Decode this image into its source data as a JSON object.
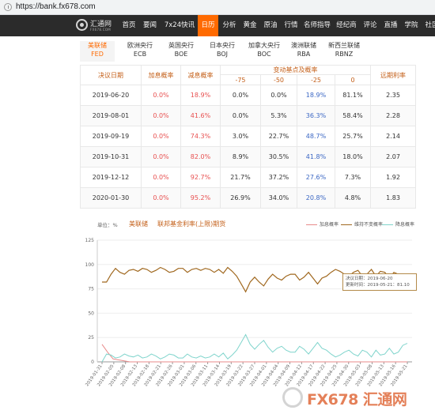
{
  "browser": {
    "url": "https://bank.fx678.com"
  },
  "logo": {
    "brand": "汇通网",
    "sub": "FX678.COM"
  },
  "nav": {
    "items": [
      {
        "label": "首页",
        "active": false
      },
      {
        "label": "要闻",
        "active": false
      },
      {
        "label": "7x24快讯",
        "active": false
      },
      {
        "label": "日历",
        "active": true
      },
      {
        "label": "分析",
        "active": false
      },
      {
        "label": "黄金",
        "active": false
      },
      {
        "label": "原油",
        "active": false
      },
      {
        "label": "行情",
        "active": false
      },
      {
        "label": "名师指导",
        "active": false
      },
      {
        "label": "经纪商",
        "active": false
      },
      {
        "label": "评论",
        "active": false
      },
      {
        "label": "直播",
        "active": false
      },
      {
        "label": "学院",
        "active": false
      },
      {
        "label": "社区",
        "active": false
      }
    ]
  },
  "tabs": [
    {
      "name": "美联储",
      "code": "FED",
      "active": true
    },
    {
      "name": "欧洲央行",
      "code": "ECB",
      "active": false
    },
    {
      "name": "英国央行",
      "code": "BOE",
      "active": false
    },
    {
      "name": "日本央行",
      "code": "BOJ",
      "active": false
    },
    {
      "name": "加拿大央行",
      "code": "BOC",
      "active": false
    },
    {
      "name": "澳洲联储",
      "code": "RBA",
      "active": false
    },
    {
      "name": "新西兰联储",
      "code": "RBNZ",
      "active": false
    }
  ],
  "table": {
    "headers": {
      "date": "决议日期",
      "hike": "加息概率",
      "cut": "减息概率",
      "change_group": "变动基点及概率",
      "change_cols": [
        "-75",
        "-50",
        "-25",
        "0"
      ],
      "forward": "远期利率"
    },
    "rows": [
      {
        "date": "2019-06-20",
        "hike": "0.0%",
        "cut": "18.9%",
        "c75": "0.0%",
        "c50": "0.0%",
        "c25": "18.9%",
        "c0": "81.1%",
        "fwd": "2.35"
      },
      {
        "date": "2019-08-01",
        "hike": "0.0%",
        "cut": "41.6%",
        "c75": "0.0%",
        "c50": "5.3%",
        "c25": "36.3%",
        "c0": "58.4%",
        "fwd": "2.28"
      },
      {
        "date": "2019-09-19",
        "hike": "0.0%",
        "cut": "74.3%",
        "c75": "3.0%",
        "c50": "22.7%",
        "c25": "48.7%",
        "c0": "25.7%",
        "fwd": "2.14"
      },
      {
        "date": "2019-10-31",
        "hike": "0.0%",
        "cut": "82.0%",
        "c75": "8.9%",
        "c50": "30.5%",
        "c25": "41.8%",
        "c0": "18.0%",
        "fwd": "2.07"
      },
      {
        "date": "2019-12-12",
        "hike": "0.0%",
        "cut": "92.7%",
        "c75": "21.7%",
        "c50": "37.2%",
        "c25": "27.6%",
        "c0": "7.3%",
        "fwd": "1.92"
      },
      {
        "date": "2020-01-30",
        "hike": "0.0%",
        "cut": "95.2%",
        "c75": "26.9%",
        "c50": "34.0%",
        "c25": "20.8%",
        "c0": "4.8%",
        "fwd": "1.83"
      }
    ]
  },
  "chart_header": {
    "unit": "单位：%",
    "title1": "美联储",
    "title2": "联邦基金利率(上限)期货"
  },
  "tooltip": {
    "line1": "决议日期：2019-06-20",
    "line2": "更新时间：2019-05-21：81.10"
  },
  "watermark": {
    "text": "FX678 汇通网"
  },
  "chart_data": {
    "type": "line",
    "ylim": [
      0,
      125
    ],
    "yticks": [
      "0",
      "25",
      "50",
      "75",
      "100",
      "125"
    ],
    "xticks": [
      "2019-01-31",
      "2019-02-05",
      "2019-02-08",
      "2019-02-13",
      "2019-02-18",
      "2019-02-21",
      "2019-02-26",
      "2019-03-01",
      "2019-03-06",
      "2019-03-11",
      "2019-03-14",
      "2019-03-19",
      "2019-03-22",
      "2019-03-27",
      "2019-04-01",
      "2019-04-04",
      "2019-04-09",
      "2019-04-12",
      "2019-04-17",
      "2019-04-22",
      "2019-04-25",
      "2019-04-30",
      "2019-05-03",
      "2019-05-08",
      "2019-05-13",
      "2019-05-16",
      "2019-05-21"
    ],
    "legend": [
      "加息概率",
      "维持不变概率",
      "降息概率"
    ],
    "colors": {
      "hike": "#e88a8a",
      "hold": "#a0681f",
      "cut": "#7fd4cc"
    },
    "series": [
      {
        "name": "加息概率",
        "values": [
          18,
          10,
          3,
          2,
          1,
          0,
          0,
          0,
          0,
          0,
          0,
          0,
          0,
          0,
          0,
          0,
          0,
          0,
          0,
          0,
          0,
          0,
          0,
          0,
          0,
          0,
          0,
          0,
          0,
          0,
          0,
          0,
          0,
          0,
          0,
          0,
          0,
          0,
          0,
          0,
          0,
          0,
          0,
          0,
          0,
          0,
          0,
          0,
          0,
          0,
          0,
          0,
          0,
          0,
          0,
          0
        ]
      },
      {
        "name": "维持不变概率",
        "values": [
          82,
          82,
          90,
          96,
          92,
          90,
          94,
          95,
          93,
          96,
          95,
          92,
          94,
          97,
          95,
          92,
          93,
          96,
          96,
          92,
          95,
          96,
          94,
          96,
          95,
          92,
          95,
          91,
          97,
          93,
          88,
          80,
          72,
          82,
          87,
          82,
          78,
          85,
          90,
          86,
          84,
          88,
          90,
          90,
          84,
          87,
          92,
          86,
          80,
          86,
          88,
          92,
          95,
          93,
          90,
          88,
          92,
          94,
          88,
          90,
          95,
          88,
          93,
          92,
          86,
          92,
          90,
          83,
          81
        ]
      },
      {
        "name": "降息概率",
        "values": [
          0,
          8,
          7,
          4,
          5,
          8,
          6,
          5,
          7,
          4,
          5,
          8,
          6,
          3,
          5,
          8,
          7,
          4,
          4,
          8,
          5,
          4,
          6,
          4,
          5,
          8,
          5,
          9,
          3,
          7,
          12,
          20,
          28,
          18,
          13,
          18,
          22,
          15,
          10,
          14,
          16,
          12,
          10,
          10,
          16,
          13,
          8,
          14,
          20,
          14,
          12,
          8,
          5,
          7,
          10,
          12,
          8,
          6,
          12,
          10,
          5,
          12,
          7,
          8,
          14,
          8,
          10,
          17,
          19
        ]
      }
    ]
  }
}
